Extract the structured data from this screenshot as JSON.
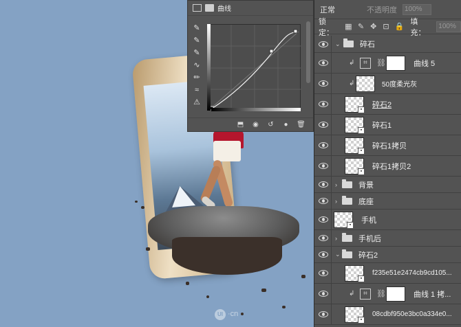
{
  "curves_panel": {
    "title": "曲线",
    "tools": [
      "eyedropper-black-icon",
      "eyedropper-gray-icon",
      "eyedropper-white-icon",
      "curve-edit-icon",
      "pencil-icon",
      "smooth-icon",
      "clipping-warning-icon"
    ],
    "footer_buttons": [
      "clip-to-layer-icon",
      "view-previous-icon",
      "reset-icon",
      "visibility-icon",
      "delete-icon"
    ]
  },
  "layers_panel": {
    "blend_mode": "正常",
    "opacity_label": "不透明度",
    "opacity_value": "100%",
    "lock_label": "锁定：",
    "fill_label": "填充：",
    "fill_value": "100%",
    "layers": [
      {
        "name": "碎石",
        "kind": "group",
        "expanded": true
      },
      {
        "name": "曲线 5",
        "kind": "adjustment"
      },
      {
        "name": "50度柔光灰",
        "kind": "pixel-clipped"
      },
      {
        "name": "碎石2",
        "kind": "smart"
      },
      {
        "name": "碎石1",
        "kind": "smart"
      },
      {
        "name": "碎石1拷贝",
        "kind": "smart"
      },
      {
        "name": "碎石1拷贝2",
        "kind": "smart"
      },
      {
        "name": "背景",
        "kind": "group",
        "expanded": false
      },
      {
        "name": "底座",
        "kind": "group",
        "expanded": false
      },
      {
        "name": "手机",
        "kind": "smart"
      },
      {
        "name": "手机后",
        "kind": "group",
        "expanded": false
      },
      {
        "name": "碎石2",
        "kind": "group",
        "expanded": true
      },
      {
        "name": "f235e51e2474cb9cd105...",
        "kind": "smart"
      },
      {
        "name": "曲线 1 拷...",
        "kind": "adjustment"
      },
      {
        "name": "08cdbf950e3bc0a334e0...",
        "kind": "smart"
      }
    ]
  },
  "watermark": {
    "badge": "UI",
    "text": "·cn"
  },
  "colors": {
    "canvas_bg": "#84a2c4",
    "panel_bg": "#535353",
    "phone_gold": "#e2c9a0"
  }
}
